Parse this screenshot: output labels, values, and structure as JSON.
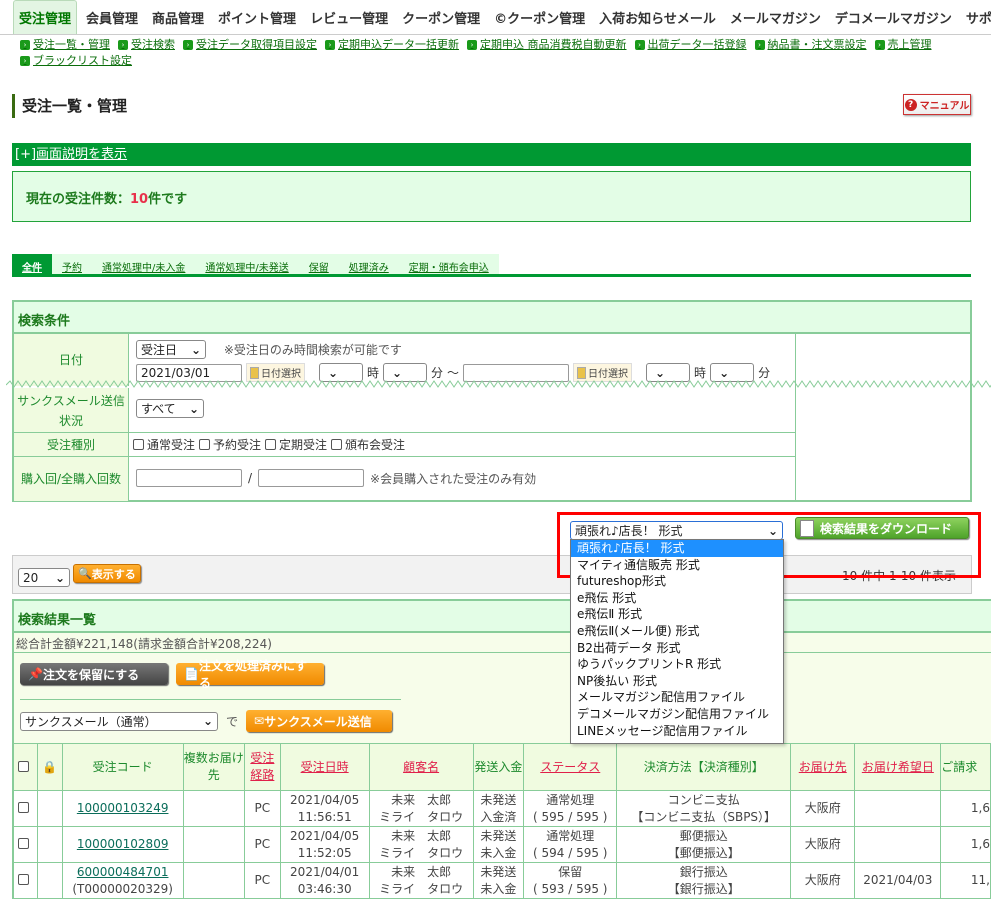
{
  "topnav": [
    "受注管理",
    "会員管理",
    "商品管理",
    "ポイント管理",
    "レビュー管理",
    "クーポン管理",
    "©クーポン管理",
    "入荷お知らせメール",
    "メールマガジン",
    "デコメールマガジン",
    "サポート"
  ],
  "subnav": [
    "受注一覧・管理",
    "受注検索",
    "受注データ取得項目設定",
    "定期申込データ一括更新",
    "定期申込 商品消費税自動更新",
    "出荷データ一括登録",
    "納品書・注文票設定",
    "売上管理",
    "ブラックリスト設定"
  ],
  "page_title": "受注一覧・管理",
  "manual_label": "マニュアル",
  "help": {
    "prefix": "[+]",
    "link": "画面説明を表示"
  },
  "count": {
    "label": "現在の受注件数：",
    "num": "10",
    "suffix": "件です"
  },
  "status_tabs": [
    "全件",
    "予約",
    "通常処理中/未入金",
    "通常処理中/未発送",
    "保留",
    "処理済み",
    "定期・頒布会申込"
  ],
  "search": {
    "title": "検索条件",
    "date_label": "日付",
    "date_type": "受注日",
    "date_note": "※受注日のみ時間検索が可能です",
    "date_from": "2021/03/01",
    "date_to": "",
    "cal_label": "日付選択",
    "hour": "時",
    "minute": "分",
    "tilde": "～",
    "thanks_label": "サンクスメール送信状況",
    "thanks_value": "すべて",
    "type_label": "受注種別",
    "types": [
      "通常受注",
      "予約受注",
      "定期受注",
      "頒布会受注"
    ],
    "purchase_label": "購入回/全購入回数",
    "slash": "/",
    "purchase_note": "※会員購入された受注のみ有効"
  },
  "download": {
    "selected": "頑張れ♪店長！ 形式",
    "button": "検索結果をダウンロード",
    "options": [
      "頑張れ♪店長！ 形式",
      "マイティ通信販売 形式",
      "futureshop形式",
      "e飛伝 形式",
      "e飛伝Ⅱ 形式",
      "e飛伝Ⅱ(メール便) 形式",
      "B2出荷データ 形式",
      "ゆうパックプリントR 形式",
      "NP後払い 形式",
      "メールマガジン配信用ファイル",
      "デコメールマガジン配信用ファイル",
      "LINEメッセージ配信用ファイル"
    ]
  },
  "paging": {
    "per_page": "20",
    "show_button": "表示する",
    "summary": "10 件中 1-10 件表示"
  },
  "results": {
    "title": "検索結果一覧",
    "total": "総合計金額¥221,148(請求金額合計¥208,224)",
    "hold_button": "注文を保留にする",
    "done_button": "注文を処理済みにする",
    "mail_select": "サンクスメール（通常）",
    "de": "で",
    "send_button": "サンクスメール送信",
    "columns": [
      "",
      "",
      "受注コード",
      "複数お届け先",
      "受注経路",
      "受注日時",
      "顧客名",
      "発送入金",
      "ステータス",
      "決済方法【決済種別】",
      "お届け先",
      "お届け希望日",
      "ご請求"
    ],
    "rows": [
      {
        "code": "100000103249",
        "sub": "",
        "route": "PC",
        "date": "2021/04/05",
        "time": "11:56:51",
        "name": "未来　太郎",
        "kana": "ミライ　タロウ",
        "ship": "未発送",
        "pay": "入金済",
        "status": "通常処理",
        "count": "( 595 / 595 )",
        "method": "コンビニ支払",
        "method_type": "【コンビニ支払（SBPS）】",
        "dest": "大阪府",
        "wish": "",
        "amount": "1,6"
      },
      {
        "code": "100000102809",
        "sub": "",
        "route": "PC",
        "date": "2021/04/05",
        "time": "11:52:05",
        "name": "未来　太郎",
        "kana": "ミライ　タロウ",
        "ship": "未発送",
        "pay": "未入金",
        "status": "通常処理",
        "count": "( 594 / 595 )",
        "method": "郵便振込",
        "method_type": "【郵便振込】",
        "dest": "大阪府",
        "wish": "",
        "amount": "1,6"
      },
      {
        "code": "600000484701",
        "sub": "(T00000020329)",
        "route": "PC",
        "date": "2021/04/01",
        "time": "03:46:30",
        "name": "未来　太郎",
        "kana": "ミライ　タロウ",
        "ship": "未発送",
        "pay": "未入金",
        "status": "保留",
        "count": "( 593 / 595 )",
        "method": "銀行振込",
        "method_type": "【銀行振込】",
        "dest": "大阪府",
        "wish": "2021/04/03",
        "amount": "11,"
      }
    ]
  },
  "colors": {
    "brand_green": "#009933",
    "light_green": "#e3fde6",
    "highlight": "#1e90ff",
    "alert_red": "#ff0000"
  }
}
